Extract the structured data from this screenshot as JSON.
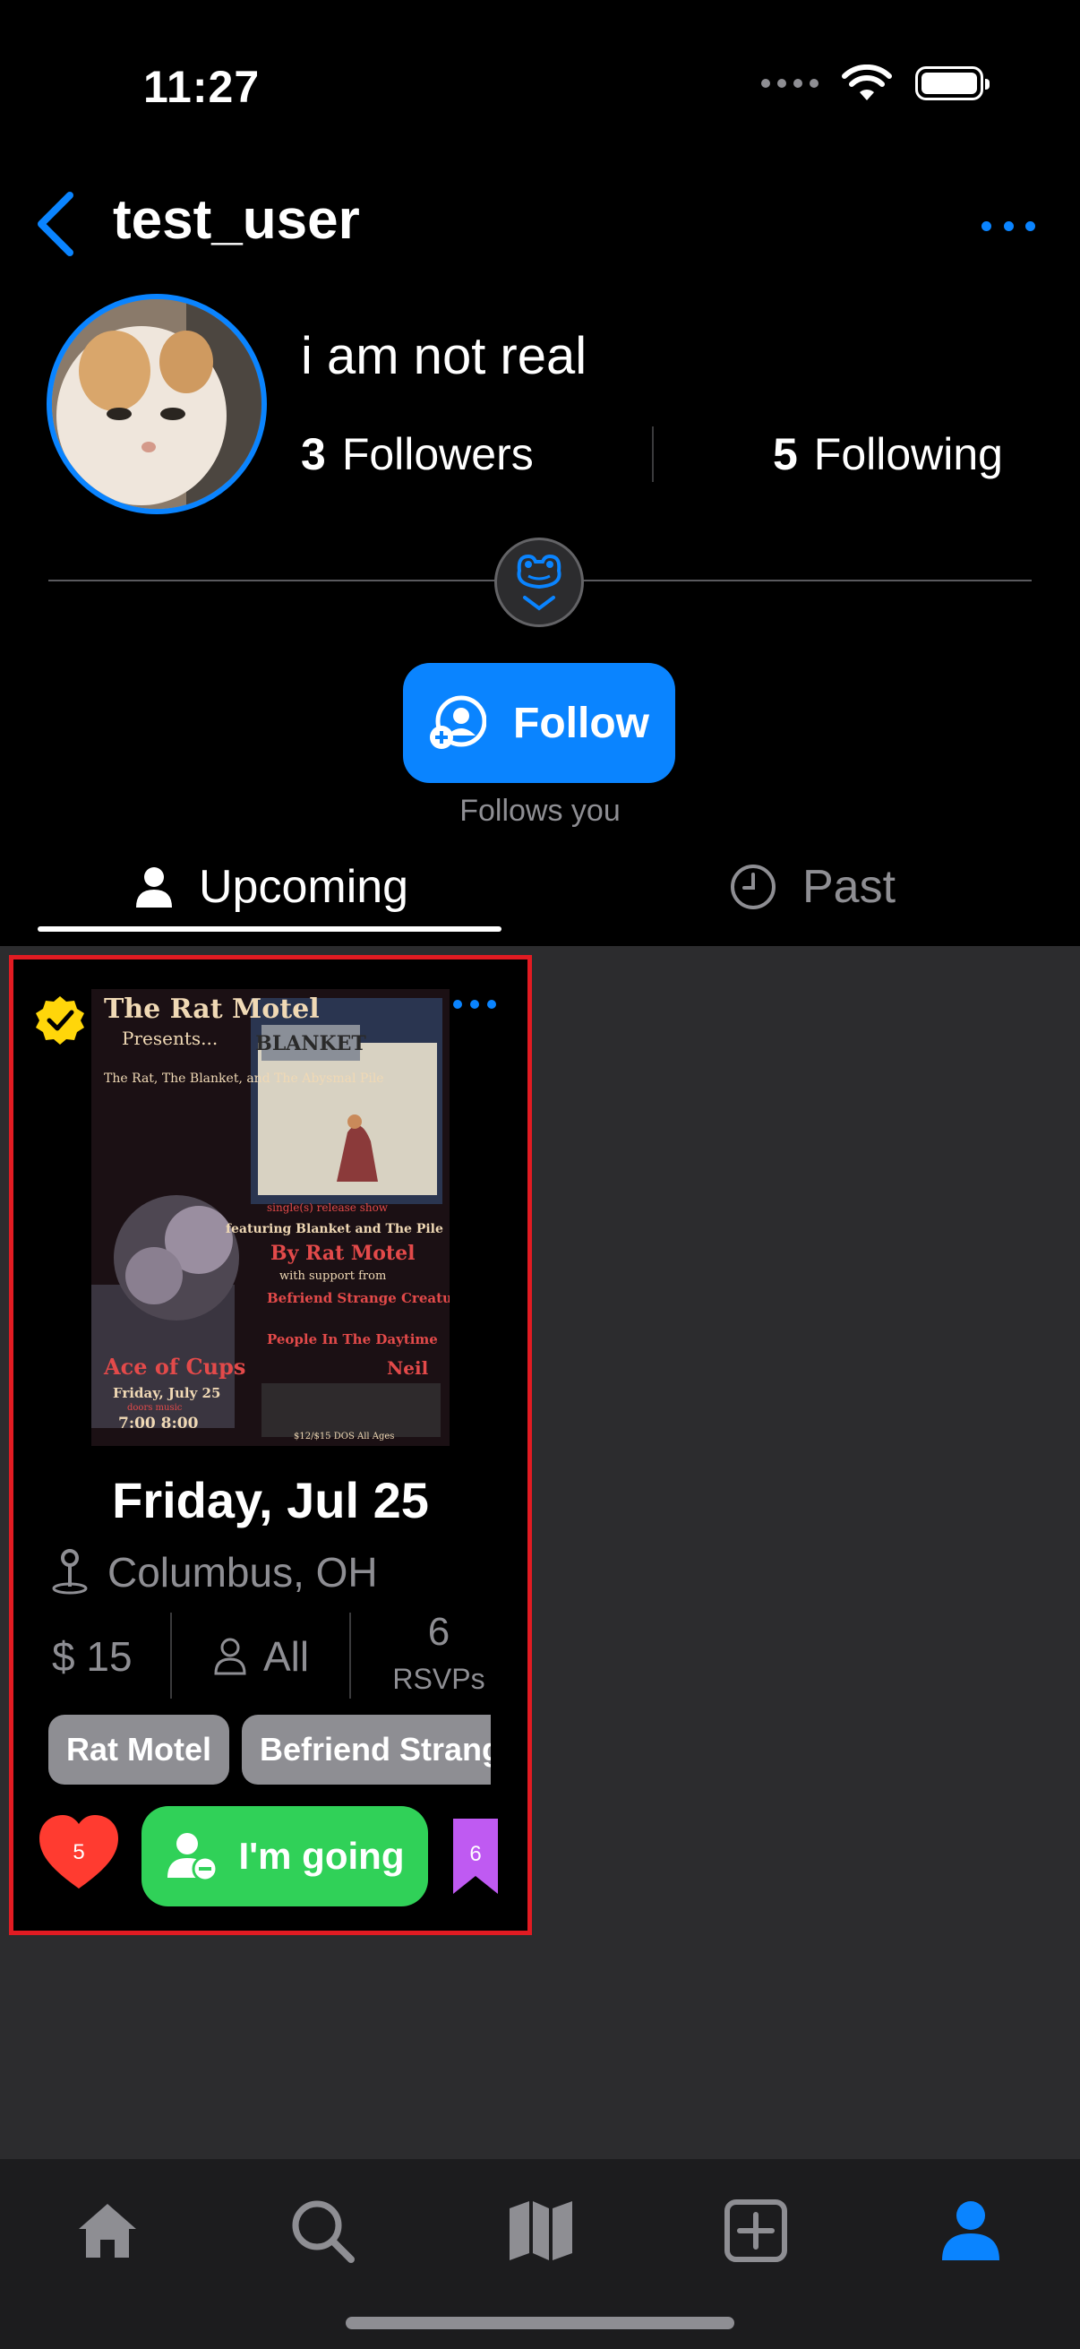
{
  "status_bar": {
    "time": "11:27"
  },
  "nav": {
    "title": "test_user"
  },
  "profile": {
    "display_name": "i am not real",
    "followers_count": "3",
    "followers_label": "Followers",
    "following_count": "5",
    "following_label": "Following"
  },
  "follow": {
    "label": "Follow",
    "subtext": "Follows you"
  },
  "tabs": [
    {
      "label": "Upcoming",
      "icon": "person-icon",
      "active": true
    },
    {
      "label": "Past",
      "icon": "clock-icon",
      "active": false
    }
  ],
  "event": {
    "poster_text": {
      "header": "The Rat Motel",
      "presents": "Presents...",
      "subtitle": "The Rat, The Blanket, and The Abysmal Pile",
      "band_sign": "BLANKET",
      "release": "single(s) release show",
      "featuring": "featuring Blanket and The Pile",
      "by": "By Rat Motel",
      "support": "with support from",
      "act1": "Befriend Strange Creatures",
      "act2": "People In The Daytime",
      "act3": "Neil",
      "venue": "Ace of Cups",
      "date": "Friday, July 25",
      "times_header": "doors   music",
      "times": "7:00  8:00",
      "footer": "$12/$15  DOS  All Ages"
    },
    "date": "Friday, Jul 25",
    "location": "Columbus, OH",
    "price": "$ 15",
    "age": "All",
    "rsvp_count": "6",
    "rsvp_label": "RSVPs",
    "tags": [
      "Rat Motel",
      "Befriend Strange Creatures"
    ],
    "likes": "5",
    "going_label": "I'm going",
    "bookmarks": "6"
  },
  "tab_bar": [
    "home-icon",
    "search-icon",
    "map-icon",
    "add-icon",
    "profile-icon"
  ],
  "colors": {
    "accent": "#0a84ff",
    "going": "#30d158",
    "like": "#ff3b30",
    "bookmark": "#bf5af2",
    "highlight": "#e11b22"
  }
}
